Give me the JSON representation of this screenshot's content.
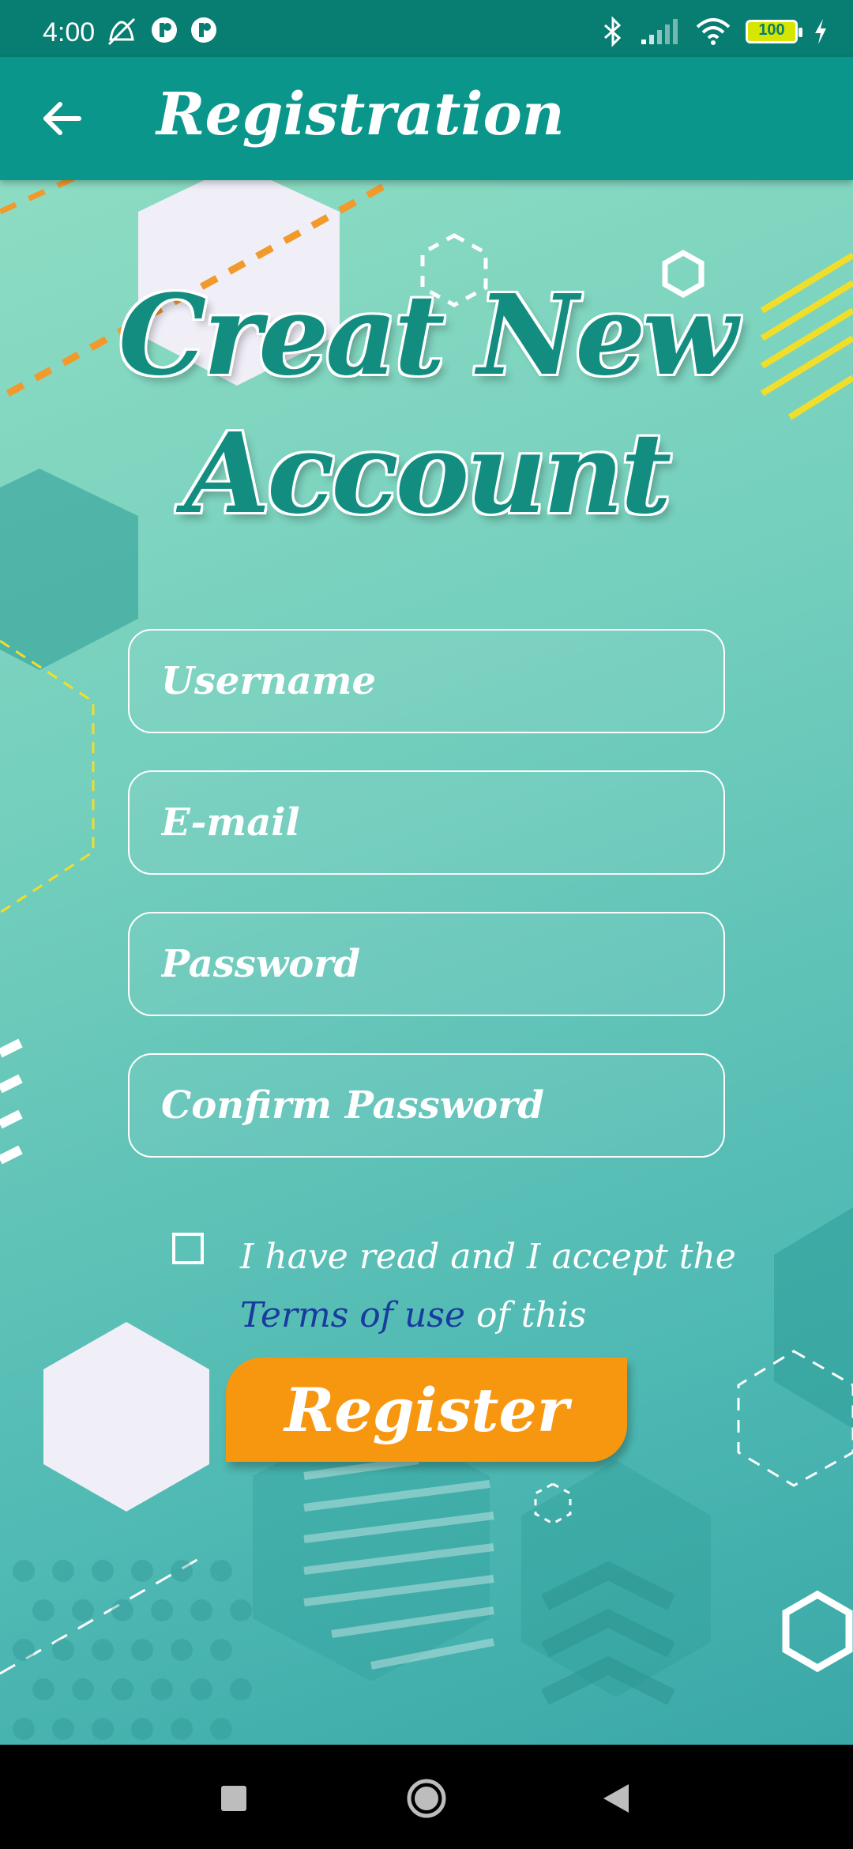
{
  "status_bar": {
    "time": "4:00",
    "battery": "100",
    "icons": [
      "alarm-off-icon",
      "app-notification-icon",
      "app-notification-icon",
      "bluetooth-icon",
      "signal-icon",
      "wifi-icon",
      "battery-icon",
      "charging-icon"
    ]
  },
  "app_bar": {
    "title": "Registration",
    "back_icon": "arrow-back-icon"
  },
  "headline": {
    "line1": "Creat New",
    "line2": "Account"
  },
  "form": {
    "username_placeholder": "Username",
    "email_placeholder": "E-mail",
    "password_placeholder": "Password",
    "confirm_password_placeholder": "Confirm Password"
  },
  "terms": {
    "checked": false,
    "prefix": "I have read and I accept the ",
    "link": "Terms of use",
    "suffix": " of this application",
    "link_color": "#1a3a9e"
  },
  "register_button": {
    "label": "Register",
    "color": "#f7970f"
  },
  "colors": {
    "app_bar": "#0a968a",
    "status_bar": "#087d71",
    "headline": "#138d80"
  },
  "nav_bar": {
    "buttons": [
      "recents-square-icon",
      "home-circle-icon",
      "back-triangle-icon"
    ]
  }
}
